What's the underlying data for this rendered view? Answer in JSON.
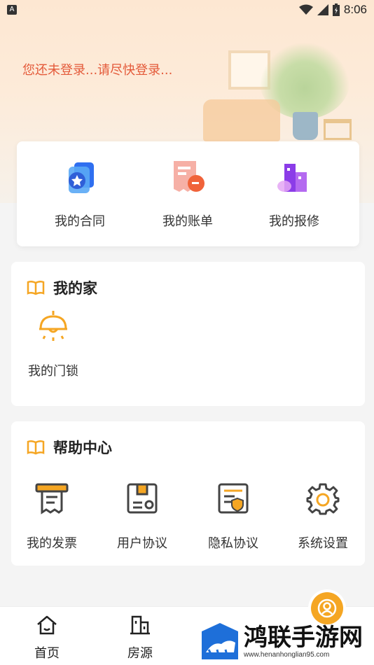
{
  "status_bar": {
    "time": "8:06",
    "notification_letter": "A"
  },
  "header": {
    "login_prompt": "您还未登录...请尽快登录..."
  },
  "quick_actions": [
    {
      "label": "我的合同",
      "icon": "contract-icon"
    },
    {
      "label": "我的账单",
      "icon": "bill-icon"
    },
    {
      "label": "我的报修",
      "icon": "repair-icon"
    }
  ],
  "my_home": {
    "title": "我的家",
    "items": [
      {
        "label": "我的门锁",
        "icon": "door-lock-icon"
      }
    ]
  },
  "help_center": {
    "title": "帮助中心",
    "items": [
      {
        "label": "我的发票",
        "icon": "invoice-icon"
      },
      {
        "label": "用户协议",
        "icon": "user-agreement-icon"
      },
      {
        "label": "隐私协议",
        "icon": "privacy-agreement-icon"
      },
      {
        "label": "系统设置",
        "icon": "settings-icon"
      }
    ]
  },
  "tab_bar": [
    {
      "label": "首页",
      "icon": "home-icon"
    },
    {
      "label": "房源",
      "icon": "building-icon"
    }
  ],
  "watermark": {
    "main": "鸿联手游网",
    "sub": "www.henanhonglian95.com"
  },
  "colors": {
    "accent": "#f5a623",
    "login_text": "#e45a3a",
    "contract_blue": "#2f6ff0",
    "bill_orange": "#f0633a",
    "repair_purple": "#8b3ce8"
  }
}
